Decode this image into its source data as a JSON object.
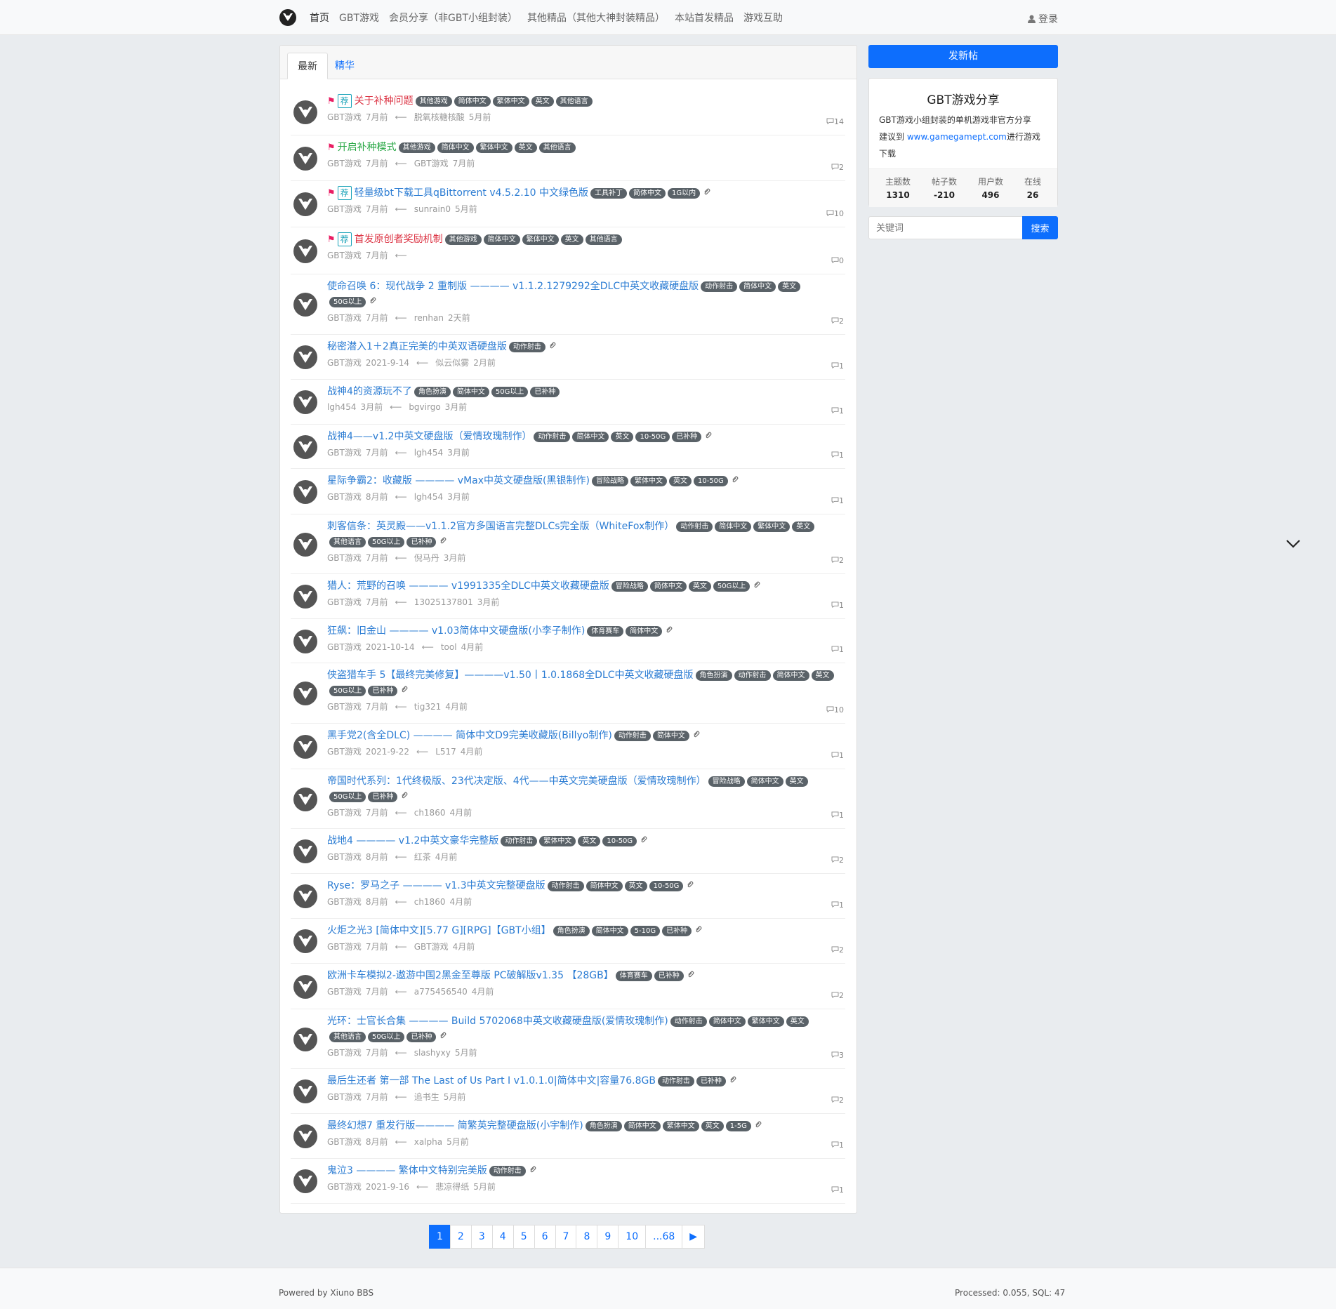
{
  "nav": {
    "links": [
      "首页",
      "GBT游戏",
      "会员分享（非GBT小组封装）",
      "其他精品（其他大神封装精品）",
      "本站首发精品",
      "游戏互助"
    ],
    "login": "登录"
  },
  "tabs": {
    "latest": "最新",
    "digest": "精华"
  },
  "threads": [
    {
      "flag": true,
      "rec": "荐",
      "title": "关于补种问题",
      "color": "red",
      "tags": [
        "其他游戏",
        "简体中文",
        "繁体中文",
        "英文",
        "其他语言"
      ],
      "attach": false,
      "author": "GBT游戏",
      "time": "7月前",
      "last_user": "脱氧核糖核酸",
      "last_time": "5月前",
      "replies": "14"
    },
    {
      "flag": true,
      "rec": "",
      "title": "开启补种模式",
      "color": "green",
      "tags": [
        "其他游戏",
        "简体中文",
        "繁体中文",
        "英文",
        "其他语言"
      ],
      "attach": false,
      "author": "GBT游戏",
      "time": "7月前",
      "last_user": "GBT游戏",
      "last_time": "7月前",
      "replies": "2"
    },
    {
      "flag": true,
      "rec": "荐",
      "title": "轻量级bt下载工具qBittorrent v4.5.2.10 中文绿色版",
      "color": "blue",
      "tags": [
        "工具补丁",
        "简体中文",
        "1G以内"
      ],
      "attach": true,
      "author": "GBT游戏",
      "time": "7月前",
      "last_user": "sunrain0",
      "last_time": "5月前",
      "replies": "10"
    },
    {
      "flag": true,
      "rec": "荐",
      "title": "首发原创者奖励机制",
      "color": "red",
      "tags": [
        "其他游戏",
        "简体中文",
        "繁体中文",
        "英文",
        "其他语言"
      ],
      "attach": false,
      "author": "GBT游戏",
      "time": "7月前",
      "last_user": "",
      "last_time": "",
      "replies": "0"
    },
    {
      "flag": false,
      "rec": "",
      "title": "使命召唤 6：现代战争 2 重制版 ———— v1.1.2.1279292全DLC中英文收藏硬盘版",
      "color": "blue",
      "tags": [
        "动作射击",
        "简体中文",
        "英文",
        "50G以上"
      ],
      "attach": true,
      "author": "GBT游戏",
      "time": "7月前",
      "last_user": "renhan",
      "last_time": "2天前",
      "replies": "2"
    },
    {
      "flag": false,
      "rec": "",
      "title": "秘密潜入1＋2真正完美的中英双语硬盘版",
      "color": "blue",
      "tags": [
        "动作射击"
      ],
      "attach": true,
      "author": "GBT游戏",
      "time": "2021-9-14",
      "last_user": "似云似雾",
      "last_time": "2月前",
      "replies": "1"
    },
    {
      "flag": false,
      "rec": "",
      "title": "战神4的资源玩不了",
      "color": "blue",
      "tags": [
        "角色扮演",
        "简体中文",
        "50G以上",
        "已补种"
      ],
      "attach": false,
      "author": "lgh454",
      "time": "3月前",
      "last_user": "bgvirgo",
      "last_time": "3月前",
      "replies": "1"
    },
    {
      "flag": false,
      "rec": "",
      "title": "战神4——v1.2中英文硬盘版（爱情玫瑰制作）",
      "color": "blue",
      "tags": [
        "动作射击",
        "简体中文",
        "英文",
        "10-50G",
        "已补种"
      ],
      "attach": true,
      "author": "GBT游戏",
      "time": "7月前",
      "last_user": "lgh454",
      "last_time": "3月前",
      "replies": "1"
    },
    {
      "flag": false,
      "rec": "",
      "title": "星际争霸2：收藏版 ———— vMax中英文硬盘版(黑银制作)",
      "color": "blue",
      "tags": [
        "冒险战略",
        "繁体中文",
        "英文",
        "10-50G"
      ],
      "attach": true,
      "author": "GBT游戏",
      "time": "8月前",
      "last_user": "lgh454",
      "last_time": "3月前",
      "replies": "1"
    },
    {
      "flag": false,
      "rec": "",
      "title": "刺客信条：英灵殿——v1.1.2官方多国语言完整DLCs完全版（WhiteFox制作）",
      "color": "blue",
      "tags": [
        "动作射击",
        "简体中文",
        "繁体中文",
        "英文",
        "其他语言",
        "50G以上",
        "已补种"
      ],
      "attach": true,
      "author": "GBT游戏",
      "time": "7月前",
      "last_user": "倪马丹",
      "last_time": "3月前",
      "replies": "2"
    },
    {
      "flag": false,
      "rec": "",
      "title": "猎人：荒野的召唤 ———— v1991335全DLC中英文收藏硬盘版",
      "color": "blue",
      "tags": [
        "冒险战略",
        "简体中文",
        "英文",
        "50G以上"
      ],
      "attach": true,
      "author": "GBT游戏",
      "time": "7月前",
      "last_user": "13025137801",
      "last_time": "3月前",
      "replies": "1"
    },
    {
      "flag": false,
      "rec": "",
      "title": "狂飙：旧金山 ———— v1.03简体中文硬盘版(小李子制作)",
      "color": "blue",
      "tags": [
        "体育赛车",
        "简体中文"
      ],
      "attach": true,
      "author": "GBT游戏",
      "time": "2021-10-14",
      "last_user": "tool",
      "last_time": "4月前",
      "replies": "1"
    },
    {
      "flag": false,
      "rec": "",
      "title": "侠盗猎车手 5【最终完美修复】————v1.50丨1.0.1868全DLC中英文收藏硬盘版",
      "color": "blue",
      "tags": [
        "角色扮演",
        "动作射击",
        "简体中文",
        "英文",
        "50G以上",
        "已补种"
      ],
      "attach": true,
      "author": "GBT游戏",
      "time": "7月前",
      "last_user": "tig321",
      "last_time": "4月前",
      "replies": "10"
    },
    {
      "flag": false,
      "rec": "",
      "title": "黑手党2(含全DLC) ———— 简体中文D9完美收藏版(Billyo制作)",
      "color": "blue",
      "tags": [
        "动作射击",
        "简体中文"
      ],
      "attach": true,
      "author": "GBT游戏",
      "time": "2021-9-22",
      "last_user": "L517",
      "last_time": "4月前",
      "replies": "1"
    },
    {
      "flag": false,
      "rec": "",
      "title": "帝国时代系列：1代终极版、23代决定版、4代——中英文完美硬盘版（爱情玫瑰制作）",
      "color": "blue",
      "tags": [
        "冒险战略",
        "简体中文",
        "英文",
        "50G以上",
        "已补种"
      ],
      "attach": true,
      "author": "GBT游戏",
      "time": "7月前",
      "last_user": "ch1860",
      "last_time": "4月前",
      "replies": "1"
    },
    {
      "flag": false,
      "rec": "",
      "title": "战地4 ———— v1.2中英文豪华完整版",
      "color": "blue",
      "tags": [
        "动作射击",
        "繁体中文",
        "英文",
        "10-50G"
      ],
      "attach": true,
      "author": "GBT游戏",
      "time": "8月前",
      "last_user": "红茶",
      "last_time": "4月前",
      "replies": "2"
    },
    {
      "flag": false,
      "rec": "",
      "title": "Ryse：罗马之子 ———— v1.3中英文完整硬盘版",
      "color": "blue",
      "tags": [
        "动作射击",
        "简体中文",
        "英文",
        "10-50G"
      ],
      "attach": true,
      "author": "GBT游戏",
      "time": "8月前",
      "last_user": "ch1860",
      "last_time": "4月前",
      "replies": "1"
    },
    {
      "flag": false,
      "rec": "",
      "title": "火炬之光3 [简体中文][5.77 G][RPG]【GBT小组】",
      "color": "blue",
      "tags": [
        "角色扮演",
        "简体中文",
        "5-10G",
        "已补种"
      ],
      "attach": true,
      "author": "GBT游戏",
      "time": "7月前",
      "last_user": "GBT游戏",
      "last_time": "4月前",
      "replies": "2"
    },
    {
      "flag": false,
      "rec": "",
      "title": "欧洲卡车模拟2-遨游中国2黑金至尊版 PC破解版v1.35 【28GB】",
      "color": "blue",
      "tags": [
        "体育赛车",
        "已补种"
      ],
      "attach": true,
      "author": "GBT游戏",
      "time": "7月前",
      "last_user": "a775456540",
      "last_time": "4月前",
      "replies": "2"
    },
    {
      "flag": false,
      "rec": "",
      "title": "光环：士官长合集 ———— Build 5702068中英文收藏硬盘版(爱情玫瑰制作)",
      "color": "blue",
      "tags": [
        "动作射击",
        "简体中文",
        "繁体中文",
        "英文",
        "其他语言",
        "50G以上",
        "已补种"
      ],
      "attach": true,
      "author": "GBT游戏",
      "time": "7月前",
      "last_user": "slashyxy",
      "last_time": "5月前",
      "replies": "3"
    },
    {
      "flag": false,
      "rec": "",
      "title": "最后生还者 第一部 The Last of Us Part I v1.0.1.0|简体中文|容量76.8GB",
      "color": "blue",
      "tags": [
        "动作射击",
        "已补种"
      ],
      "attach": true,
      "author": "GBT游戏",
      "time": "7月前",
      "last_user": "追书生",
      "last_time": "5月前",
      "replies": "2"
    },
    {
      "flag": false,
      "rec": "",
      "title": "最终幻想7 重发行版———— 简繁英完整硬盘版(小宇制作)",
      "color": "blue",
      "tags": [
        "角色扮演",
        "简体中文",
        "繁体中文",
        "英文",
        "1-5G"
      ],
      "attach": true,
      "author": "GBT游戏",
      "time": "8月前",
      "last_user": "xalpha",
      "last_time": "5月前",
      "replies": "1"
    },
    {
      "flag": false,
      "rec": "",
      "title": "鬼泣3 ———— 繁体中文特别完美版",
      "color": "blue",
      "tags": [
        "动作射击"
      ],
      "attach": true,
      "author": "GBT游戏",
      "time": "2021-9-16",
      "last_user": "悲凉得纸",
      "last_time": "5月前",
      "replies": "1"
    }
  ],
  "pagination": [
    "1",
    "2",
    "3",
    "4",
    "5",
    "6",
    "7",
    "8",
    "9",
    "10",
    "...68",
    "▶"
  ],
  "footer": {
    "left": "Powered by Xiuno BBS",
    "right": "Processed: 0.055, SQL: 47"
  },
  "sidebar": {
    "new_post": "发新帖",
    "site_title": "GBT游戏分享",
    "desc_line1": "GBT游戏小组封装的单机游戏非官方分享",
    "desc_prefix": "建议到 ",
    "desc_link": "www.gamegamept.com",
    "desc_suffix": "进行游戏下载",
    "stats": [
      {
        "label": "主题数",
        "value": "1310"
      },
      {
        "label": "帖子数",
        "value": "-210"
      },
      {
        "label": "用户数",
        "value": "496"
      },
      {
        "label": "在线",
        "value": "26"
      }
    ],
    "search_placeholder": "关键词",
    "search_button": "搜索"
  },
  "colors": {
    "primary": "#0d6efd",
    "title_blue": "#2b7cd3",
    "tag_bg": "#5a6268",
    "flag": "#e91e63"
  }
}
